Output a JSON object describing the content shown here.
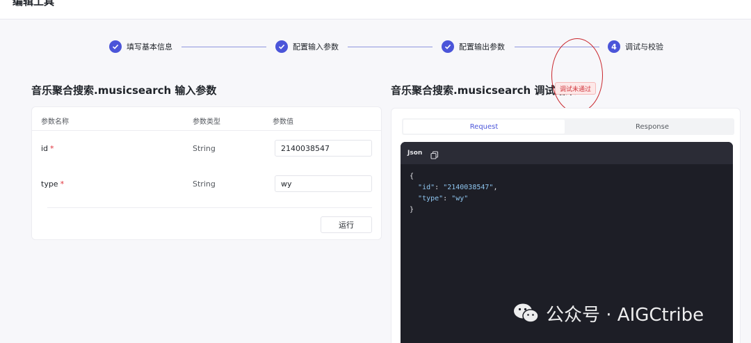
{
  "header": {
    "title": "编辑工具"
  },
  "steps": [
    {
      "label": "填写基本信息",
      "state": "done",
      "number": ""
    },
    {
      "label": "配置输入参数",
      "state": "done",
      "number": ""
    },
    {
      "label": "配置输出参数",
      "state": "done",
      "number": ""
    },
    {
      "label": "调试与校验",
      "state": "current",
      "number": "4"
    }
  ],
  "left": {
    "title": "音乐聚合搜索.musicsearch 输入参数",
    "columns": [
      "参数名称",
      "参数类型",
      "参数值"
    ],
    "rows": [
      {
        "name": "id",
        "required": "*",
        "type": "String",
        "value": "2140038547"
      },
      {
        "name": "type",
        "required": "*",
        "type": "String",
        "value": "wy"
      }
    ],
    "run_label": "运行"
  },
  "right": {
    "title": "音乐聚合搜索.musicsearch 调试结果",
    "status": "调试未通过",
    "tabs": [
      "Request",
      "Response"
    ],
    "active_tab": "Request",
    "code_lang": "Json",
    "code": {
      "open": "{",
      "line1_key": "\"id\"",
      "line1_val": "\"2140038547\"",
      "line2_key": "\"type\"",
      "line2_val": "\"wy\"",
      "close": "}"
    }
  },
  "watermark": "公众号 · AIGCtribe",
  "colors": {
    "accent": "#4b55d9",
    "error": "#d0353c",
    "annotation": "#c9262c"
  }
}
